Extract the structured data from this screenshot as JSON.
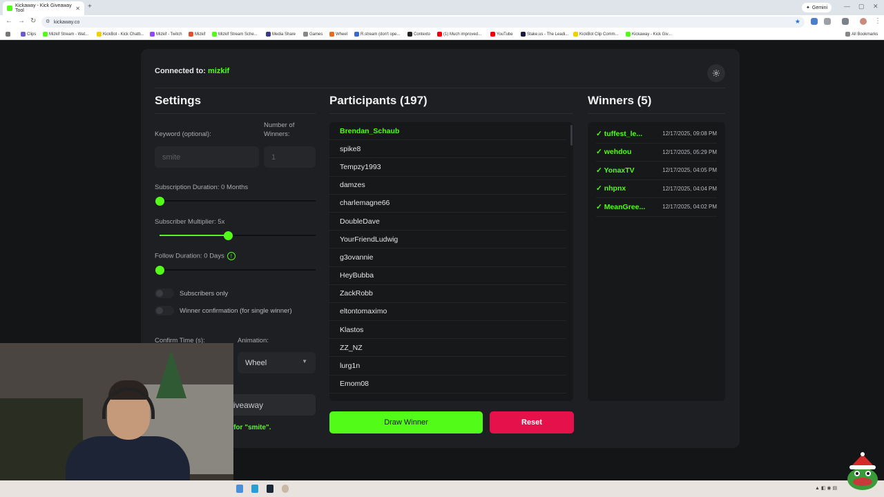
{
  "browser": {
    "tab_title": "Kickaway - Kick Giveaway Tool",
    "url": "kickaway.co",
    "gemini_label": "Gemini",
    "bookmarks": [
      "Clips",
      "Mizkif Stream - Wat...",
      "KickBot - Kick Chatb...",
      "Mizkif - Twitch",
      "Mizkif",
      "Mizkif Stream Sche...",
      "Media Share",
      "Games",
      "Wheel",
      "R.stream (don't ope...",
      "Contexto",
      "(1) Much improved...",
      "YouTube",
      "Stake.us - The Leadi...",
      "KickBot Clip Comm...",
      "Kickaway - Kick Giv...",
      "All Bookmarks"
    ]
  },
  "header": {
    "connected_label": "Connected to:",
    "username": "mizkif"
  },
  "settings": {
    "title": "Settings",
    "keyword_label": "Keyword (optional):",
    "keyword_placeholder": "smite",
    "winners_label_line1": "Number of",
    "winners_label_line2": "Winners:",
    "winners_value": "1",
    "sub_duration_label": "Subscription Duration: 0 Months",
    "sub_duration_level": 0,
    "sub_multiplier_label": "Subscriber Multiplier: 5x",
    "sub_multiplier_level": 0.44,
    "follow_duration_label": "Follow Duration: 0 Days",
    "follow_duration_level": 0,
    "subscribers_only_label": "Subscribers only",
    "winner_confirm_label": "Winner confirmation (for single winner)",
    "confirm_time_label": "Confirm Time (s):",
    "animation_label": "Animation:",
    "animation_value": "Wheel",
    "start_button_label": "Start Giveaway",
    "status_text": "Waiting for \"smite\"."
  },
  "participants": {
    "title": "Participants (197)",
    "names": [
      "Brendan_Schaub",
      "spike8",
      "Tempzy1993",
      "damzes",
      "charlemagne66",
      "DoubleDave",
      "YourFriendLudwig",
      "g3ovannie",
      "HeyBubba",
      "ZackRobb",
      "eltontomaximo",
      "Klastos",
      "ZZ_NZ",
      "lurg1n",
      "Emom08"
    ]
  },
  "winners": {
    "title": "Winners (5)",
    "items": [
      {
        "name": "tuffest_le...",
        "date": "12/17/2025, 09:08 PM"
      },
      {
        "name": "wehdou",
        "date": "12/17/2025, 05:29 PM"
      },
      {
        "name": "YonaxTV",
        "date": "12/17/2025, 04:05 PM"
      },
      {
        "name": "nhpnx",
        "date": "12/17/2025, 04:04 PM"
      },
      {
        "name": "MeanGree...",
        "date": "12/17/2025, 04:02 PM"
      }
    ]
  },
  "actions": {
    "draw_label": "Draw Winner",
    "reset_label": "Reset"
  },
  "colors": {
    "accent": "#53fc18",
    "danger": "#e5114b",
    "panel": "#1e1f22",
    "background": "#141517"
  }
}
